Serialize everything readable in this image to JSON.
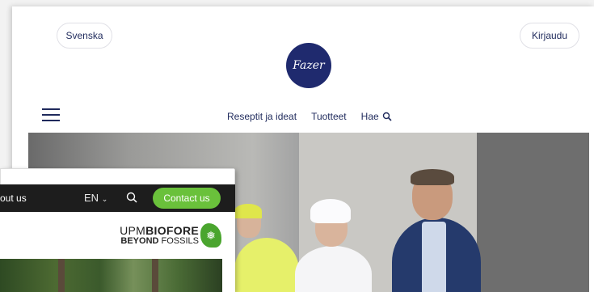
{
  "fazer": {
    "language_label": "Svenska",
    "login_label": "Kirjaudu",
    "logo_text": "Fazer",
    "nav": [
      "Reseptit ja ideat",
      "Tuotteet",
      "Hae"
    ],
    "brand_color": "#1f2a6e"
  },
  "upm": {
    "about_label": "out us",
    "lang_label": "EN",
    "contact_label": "Contact us",
    "brand_line1_light": "UPM",
    "brand_line1_bold": "BIOFORE",
    "brand_line2_bold": "BEYOND",
    "brand_line2_light": " FOSSILS",
    "accent_color": "#6ac13b"
  }
}
